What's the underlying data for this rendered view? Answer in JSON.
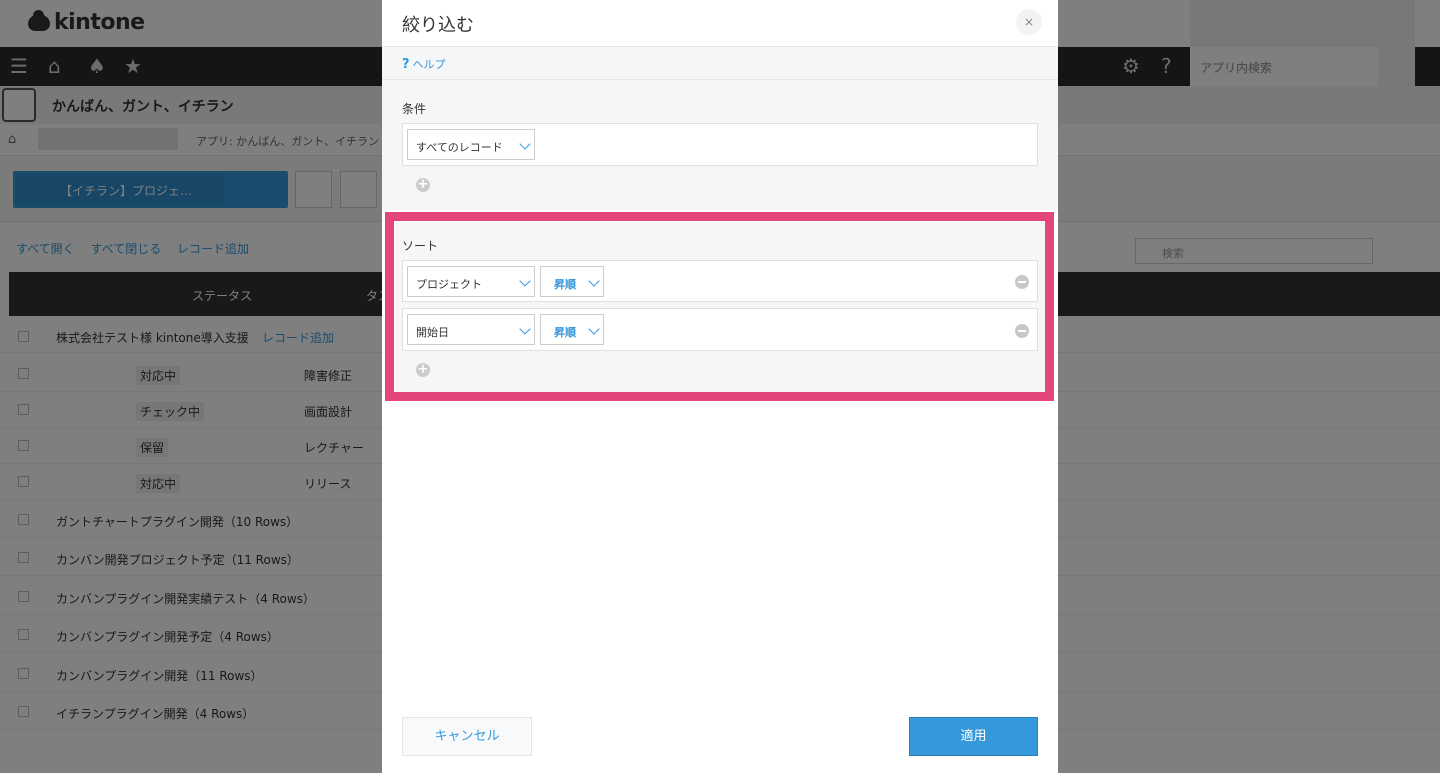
{
  "app": {
    "logo": "kintone",
    "search_placeholder": "アプリ内検索",
    "app_name": "かんばん、ガント、イチラン",
    "breadcrumb_app": "アプリ: かんばん、ガント、イチラン",
    "view_name": "【イチラン】プロジェ…",
    "links": [
      "すべて開く",
      "すべて閉じる",
      "レコード追加"
    ],
    "list_search_placeholder": "検索",
    "columns": [
      "ステータス",
      "タス"
    ],
    "group1": "株式会社テスト様 kintone導入支援",
    "add_record": "レコード追加",
    "rows": [
      {
        "status": "対応中",
        "task": "障害修正"
      },
      {
        "status": "チェック中",
        "task": "画面設計"
      },
      {
        "status": "保留",
        "task": "レクチャー"
      },
      {
        "status": "対応中",
        "task": "リリース"
      }
    ],
    "groups": [
      "ガントチャートプラグイン開発（10 Rows）",
      "カンバン開発プロジェクト予定（11 Rows）",
      "カンバンプラグイン開発実績テスト（4 Rows）",
      "カンバンプラグイン開発予定（4 Rows）",
      "カンバンプラグイン開発（11 Rows）",
      "イチランプラグイン開発（4 Rows）"
    ]
  },
  "modal": {
    "title": "絞り込む",
    "close_label": "×",
    "help_label": "ヘルプ",
    "condition_label": "条件",
    "condition_select": "すべてのレコード",
    "sort_label": "ソート",
    "sort_rows": [
      {
        "field": "プロジェクト",
        "order": "昇順"
      },
      {
        "field": "開始日",
        "order": "昇順"
      }
    ],
    "cancel_label": "キャンセル",
    "apply_label": "適用"
  },
  "colors": {
    "accent": "#3498db",
    "highlight": "#e3457c"
  }
}
